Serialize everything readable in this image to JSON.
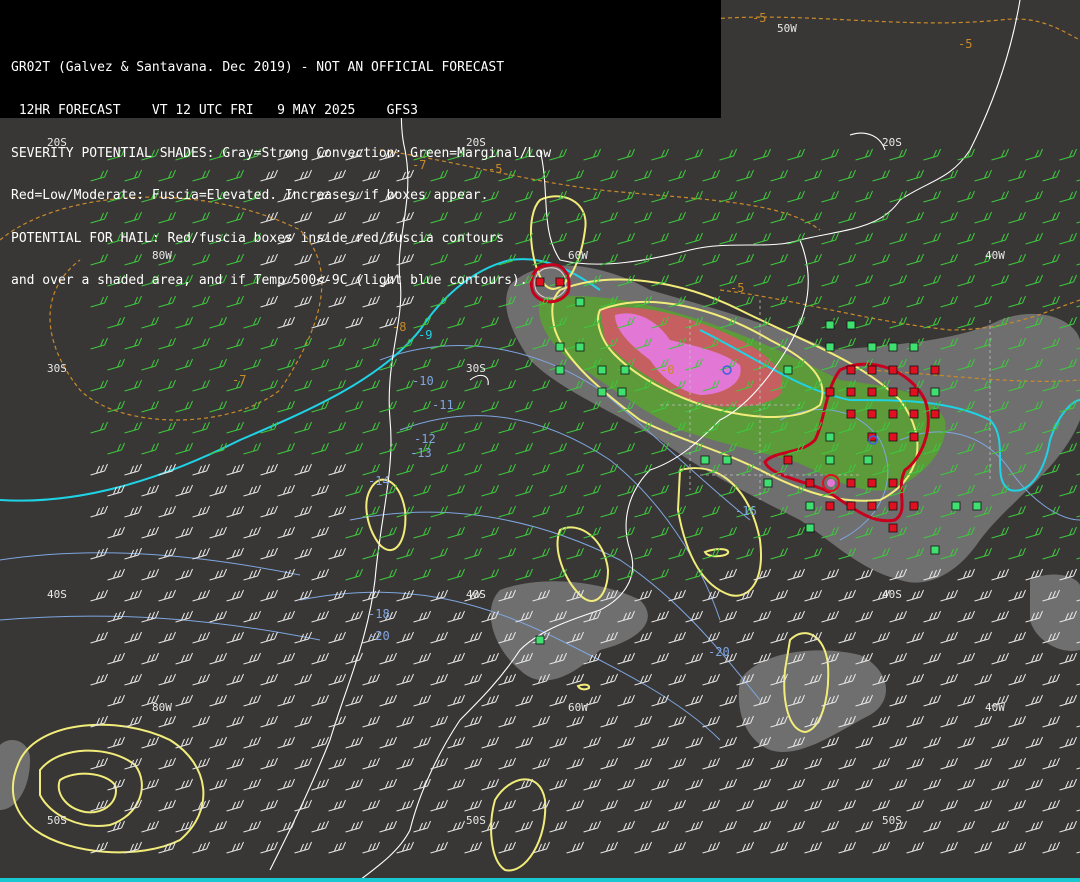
{
  "header": {
    "lines": [
      "GR02T (Galvez & Santavana. Dec 2019) - NOT AN OFFICIAL FORECAST",
      " 12HR FORECAST    VT 12 UTC FRI   9 MAY 2025    GFS3",
      "SEVERITY POTENTIAL SHADES: Gray=Strong Convection: Green=Marginal/Low",
      "Red=Low/Moderate: Fuscia=Elevated. Increases if boxes appear.",
      "POTENTIAL FOR HAIL: Red/fuscia boxes inside red/fuscia contours",
      "and over a shaded area, and if Temp 500<-9C (light blue contours)."
    ]
  },
  "grid_labels": {
    "lat_20s": "20S",
    "lat_30s": "30S",
    "lat_40s": "40S",
    "lat_50s": "50S",
    "lon_80w": "80W",
    "lon_60w": "60W",
    "lon_50w": "50W",
    "lon_40w": "40W"
  },
  "temp_labels": {
    "t_m5": "-5",
    "t_m7": "-7",
    "t_m8": "-8",
    "t_m9": "-9",
    "t_m10": "-10",
    "t_m11": "-11",
    "t_m12": "-12",
    "t_m13": "-13",
    "t_m14": "-14",
    "t_m16": "-16",
    "t_m18": "-18",
    "t_m20": "-20",
    "t_m0": "-0"
  },
  "colors": {
    "background": "#383735",
    "coast": "#ffffff",
    "wind_barb_green": "#3ec83e",
    "wind_barb_white": "#e6e6e6",
    "contour_yellow": "#f2ec7a",
    "contour_cyan": "#1fd3e6",
    "contour_lightblue": "#7fa6e0",
    "contour_orange_dashed": "#c98a2a",
    "shade_gray": "#7a7a7a",
    "shade_green": "#5a9e3a",
    "shade_red": "#c25a5a",
    "shade_fuscia": "#e070d0",
    "hail_red_contour": "#c8001e",
    "box_green": "#40e070",
    "box_red": "#e01020"
  }
}
